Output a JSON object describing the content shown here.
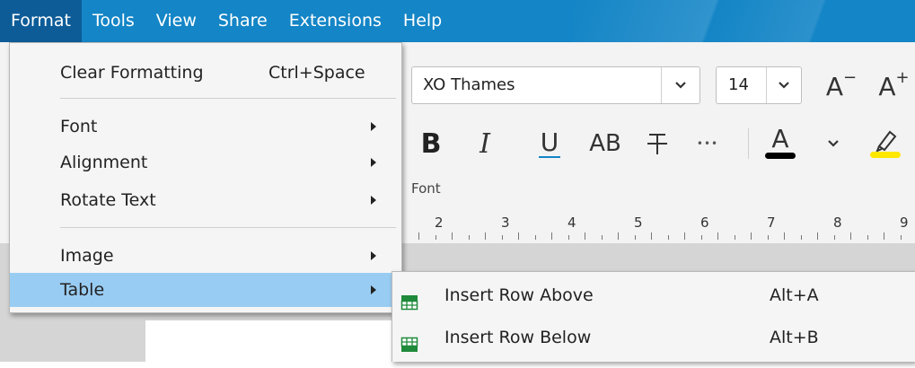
{
  "menubar": {
    "items": [
      {
        "label": "Format"
      },
      {
        "label": "Tools"
      },
      {
        "label": "View"
      },
      {
        "label": "Share"
      },
      {
        "label": "Extensions"
      },
      {
        "label": "Help"
      }
    ]
  },
  "ribbon": {
    "font_name": "XO Thames",
    "font_size": "14",
    "grow_label": "A",
    "grow_sup": "+",
    "shrink_label": "A",
    "shrink_sup": "−",
    "bold": "B",
    "italic": "I",
    "underline": "U",
    "allcaps": "AB",
    "more": "•••",
    "font_color_label": "A",
    "group_label": "Font",
    "font_color_swatch": "#000000",
    "highlight_swatch": "#ffe800"
  },
  "ruler": {
    "numbers": [
      "2",
      "3",
      "4",
      "5",
      "6",
      "7",
      "8",
      "9"
    ]
  },
  "format_menu": {
    "clear_formatting": {
      "label": "Clear Formatting",
      "shortcut": "Ctrl+Space"
    },
    "font": {
      "label": "Font"
    },
    "alignment": {
      "label": "Alignment"
    },
    "rotate_text": {
      "label": "Rotate Text"
    },
    "image": {
      "label": "Image"
    },
    "table": {
      "label": "Table"
    }
  },
  "table_submenu": {
    "insert_row_above": {
      "label": "Insert Row Above",
      "shortcut": "Alt+A"
    },
    "insert_row_below": {
      "label": "Insert Row Below",
      "shortcut": "Alt+B"
    }
  },
  "colors": {
    "menubar": "#1485c6",
    "menubar_active": "#0d5c98",
    "hover": "#99ccf2",
    "table_icon": "#1f8a3b"
  }
}
